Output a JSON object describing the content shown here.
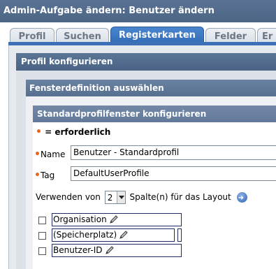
{
  "window": {
    "title": "Admin-Aufgabe ändern: Benutzer ändern"
  },
  "tabs": [
    {
      "label": "Profil",
      "active": false
    },
    {
      "label": "Suchen",
      "active": false
    },
    {
      "label": "Registerkarten",
      "active": true
    },
    {
      "label": "Felder",
      "active": false
    },
    {
      "label": "Er",
      "active": false
    }
  ],
  "sections": {
    "profile_config": "Profil konfigurieren",
    "window_definition": "Fensterdefinition auswählen",
    "default_profile_window": "Standardprofilfenster konfigurieren"
  },
  "legend": {
    "dot": "•",
    "text": " = erforderlich"
  },
  "form": {
    "name_label": "Name",
    "name_value": "Benutzer - Standardprofil",
    "tag_label": "Tag",
    "tag_value": "DefaultUserProfile",
    "uses_prefix": "Verwenden von",
    "columns_value": "2",
    "uses_suffix": "Spalte(n) für das Layout"
  },
  "fields": [
    {
      "label": "Organisation",
      "checked": false
    },
    {
      "label": "(Speicherplatz)",
      "checked": false
    },
    {
      "label": "Benutzer-ID",
      "checked": false
    }
  ],
  "icons": {
    "edit": "pencil-icon",
    "go": "go-arrow-icon",
    "required": "required-dot"
  },
  "colors": {
    "title_bg": "#4c6585",
    "active_tab": "#2f68b3",
    "required_dot": "#e8661c",
    "item_border": "#1e2b66"
  }
}
